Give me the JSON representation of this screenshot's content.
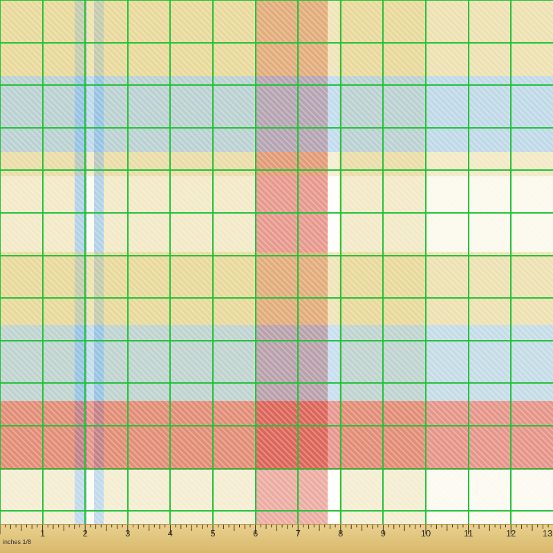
{
  "fabric": {
    "pattern": "tartan plaid",
    "colors": {
      "base": "#f6f0d6",
      "yellow": "#e2cf84",
      "blue": "#8fc1e6",
      "red": "#d9544a",
      "white": "#ffffff",
      "grid_line": "#22c23a"
    }
  },
  "ruler": {
    "unit_label": "inches 1/8",
    "numbers": [
      "1",
      "2",
      "3",
      "4",
      "5",
      "6",
      "7",
      "8",
      "9",
      "10",
      "11",
      "12",
      "13"
    ]
  }
}
